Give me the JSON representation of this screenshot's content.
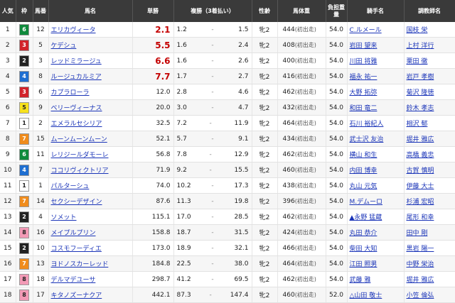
{
  "headers": {
    "popularity": "人気",
    "waku": "枠",
    "umaban": "馬番",
    "name": "馬名",
    "win": "単勝",
    "place": "複勝（3着払い）",
    "sexage": "性齢",
    "weight": "馬体重",
    "load": "負担重量",
    "jockey": "騎手名",
    "trainer": "調教師名"
  },
  "colors": {
    "waku": {
      "1": "#ffffff",
      "2": "#222222",
      "3": "#d2232a",
      "4": "#1f6fd1",
      "5": "#f7e11b",
      "6": "#0f8a3c",
      "7": "#f08c1c",
      "8": "#f29ab6"
    },
    "hot_odds": "#c40000",
    "link": "#1a34b8"
  },
  "rows": [
    {
      "pop": "1",
      "waku": "6",
      "num": "12",
      "name": "エリカヴィータ",
      "win": "2.1",
      "plo": "1.2",
      "phi": "1.5",
      "sa": "牝2",
      "bw": "444",
      "bwn": "(初出走)",
      "kin": "54.0",
      "jockey": "C.ルメール",
      "trainer": "国枝 栄",
      "hot": true
    },
    {
      "pop": "2",
      "waku": "3",
      "num": "5",
      "name": "ケデシュ",
      "win": "5.5",
      "plo": "1.6",
      "phi": "2.4",
      "sa": "牝2",
      "bw": "408",
      "bwn": "(初出走)",
      "kin": "54.0",
      "jockey": "岩田 望来",
      "trainer": "上村 洋行",
      "hot": true
    },
    {
      "pop": "3",
      "waku": "2",
      "num": "3",
      "name": "レッドミラージュ",
      "win": "6.6",
      "plo": "1.6",
      "phi": "2.6",
      "sa": "牝2",
      "bw": "400",
      "bwn": "(初出走)",
      "kin": "54.0",
      "jockey": "川田 将雅",
      "trainer": "栗田 徹",
      "hot": true
    },
    {
      "pop": "4",
      "waku": "4",
      "num": "8",
      "name": "ルージュカルミア",
      "win": "7.7",
      "plo": "1.7",
      "phi": "2.7",
      "sa": "牝2",
      "bw": "416",
      "bwn": "(初出走)",
      "kin": "54.0",
      "jockey": "福永 祐一",
      "trainer": "岩戸 孝樹",
      "hot": true
    },
    {
      "pop": "5",
      "waku": "3",
      "num": "6",
      "name": "カプラローラ",
      "win": "12.0",
      "plo": "2.8",
      "phi": "4.6",
      "sa": "牝2",
      "bw": "462",
      "bwn": "(初出走)",
      "kin": "54.0",
      "jockey": "大野 拓弥",
      "trainer": "菊沢 隆徳",
      "hot": false
    },
    {
      "pop": "6",
      "waku": "5",
      "num": "9",
      "name": "ベリーヴィーナス",
      "win": "20.0",
      "plo": "3.0",
      "phi": "4.7",
      "sa": "牝2",
      "bw": "432",
      "bwn": "(初出走)",
      "kin": "54.0",
      "jockey": "和田 竜二",
      "trainer": "鈴木 孝志",
      "hot": false
    },
    {
      "pop": "7",
      "waku": "1",
      "num": "2",
      "name": "エメラルセシリア",
      "win": "32.5",
      "plo": "7.2",
      "phi": "11.9",
      "sa": "牝2",
      "bw": "464",
      "bwn": "(初出走)",
      "kin": "54.0",
      "jockey": "石川 裕紀人",
      "trainer": "相沢 郁",
      "hot": false
    },
    {
      "pop": "8",
      "waku": "7",
      "num": "15",
      "name": "ムーンムーンムーン",
      "win": "52.1",
      "plo": "5.7",
      "phi": "9.1",
      "sa": "牝2",
      "bw": "434",
      "bwn": "(初出走)",
      "kin": "54.0",
      "jockey": "武士沢 友治",
      "trainer": "堀井 雅広",
      "hot": false
    },
    {
      "pop": "9",
      "waku": "6",
      "num": "11",
      "name": "レリジールダモーレ",
      "win": "56.8",
      "plo": "7.8",
      "phi": "12.9",
      "sa": "牝2",
      "bw": "462",
      "bwn": "(初出走)",
      "kin": "54.0",
      "jockey": "横山 和生",
      "trainer": "高橋 義忠",
      "hot": false
    },
    {
      "pop": "10",
      "waku": "4",
      "num": "7",
      "name": "ココリヴィクトリア",
      "win": "71.9",
      "plo": "9.2",
      "phi": "15.5",
      "sa": "牝2",
      "bw": "460",
      "bwn": "(初出走)",
      "kin": "54.0",
      "jockey": "内田 博幸",
      "trainer": "古賀 慎明",
      "hot": false
    },
    {
      "pop": "11",
      "waku": "1",
      "num": "1",
      "name": "パルターシュ",
      "win": "74.0",
      "plo": "10.2",
      "phi": "17.3",
      "sa": "牝2",
      "bw": "438",
      "bwn": "(初出走)",
      "kin": "54.0",
      "jockey": "丸山 元気",
      "trainer": "伊藤 大士",
      "hot": false
    },
    {
      "pop": "12",
      "waku": "7",
      "num": "14",
      "name": "セクシーデザイン",
      "win": "87.6",
      "plo": "11.3",
      "phi": "19.8",
      "sa": "牝2",
      "bw": "396",
      "bwn": "(初出走)",
      "kin": "54.0",
      "jockey": "M.デムーロ",
      "trainer": "杉浦 宏昭",
      "hot": false
    },
    {
      "pop": "13",
      "waku": "2",
      "num": "4",
      "name": "ソメット",
      "win": "115.1",
      "plo": "17.0",
      "phi": "28.5",
      "sa": "牝2",
      "bw": "462",
      "bwn": "(初出走)",
      "kin": "54.0",
      "jockey": "▲永野 猛蔵",
      "trainer": "尾形 和幸",
      "hot": false
    },
    {
      "pop": "14",
      "waku": "8",
      "num": "16",
      "name": "メイプルプリン",
      "win": "158.8",
      "plo": "18.7",
      "phi": "31.5",
      "sa": "牝2",
      "bw": "424",
      "bwn": "(初出走)",
      "kin": "54.0",
      "jockey": "丸田 恭介",
      "trainer": "田中 剛",
      "hot": false
    },
    {
      "pop": "15",
      "waku": "2",
      "num": "10",
      "name": "コスモフーディエ",
      "win": "173.0",
      "plo": "18.9",
      "phi": "32.1",
      "sa": "牝2",
      "bw": "466",
      "bwn": "(初出走)",
      "kin": "54.0",
      "jockey": "柴田 大知",
      "trainer": "黒岩 陽一",
      "hot": false
    },
    {
      "pop": "16",
      "waku": "7",
      "num": "13",
      "name": "ヨドノスカーレッド",
      "win": "184.8",
      "plo": "22.5",
      "phi": "38.0",
      "sa": "牝2",
      "bw": "464",
      "bwn": "(初出走)",
      "kin": "54.0",
      "jockey": "江田 照男",
      "trainer": "中野 栄治",
      "hot": false
    },
    {
      "pop": "17",
      "waku": "8",
      "num": "18",
      "name": "デルマデユーサ",
      "win": "298.7",
      "plo": "41.2",
      "phi": "69.5",
      "sa": "牝2",
      "bw": "462",
      "bwn": "(初出走)",
      "kin": "54.0",
      "jockey": "武藤 雅",
      "trainer": "堀井 雅広",
      "hot": false
    },
    {
      "pop": "18",
      "waku": "8",
      "num": "17",
      "name": "キタノズーナクア",
      "win": "442.1",
      "plo": "87.3",
      "phi": "147.4",
      "sa": "牝2",
      "bw": "460",
      "bwn": "(初出走)",
      "kin": "52.0",
      "jockey": "△山田 敬士",
      "trainer": "小笠 倫弘",
      "hot": false
    }
  ]
}
